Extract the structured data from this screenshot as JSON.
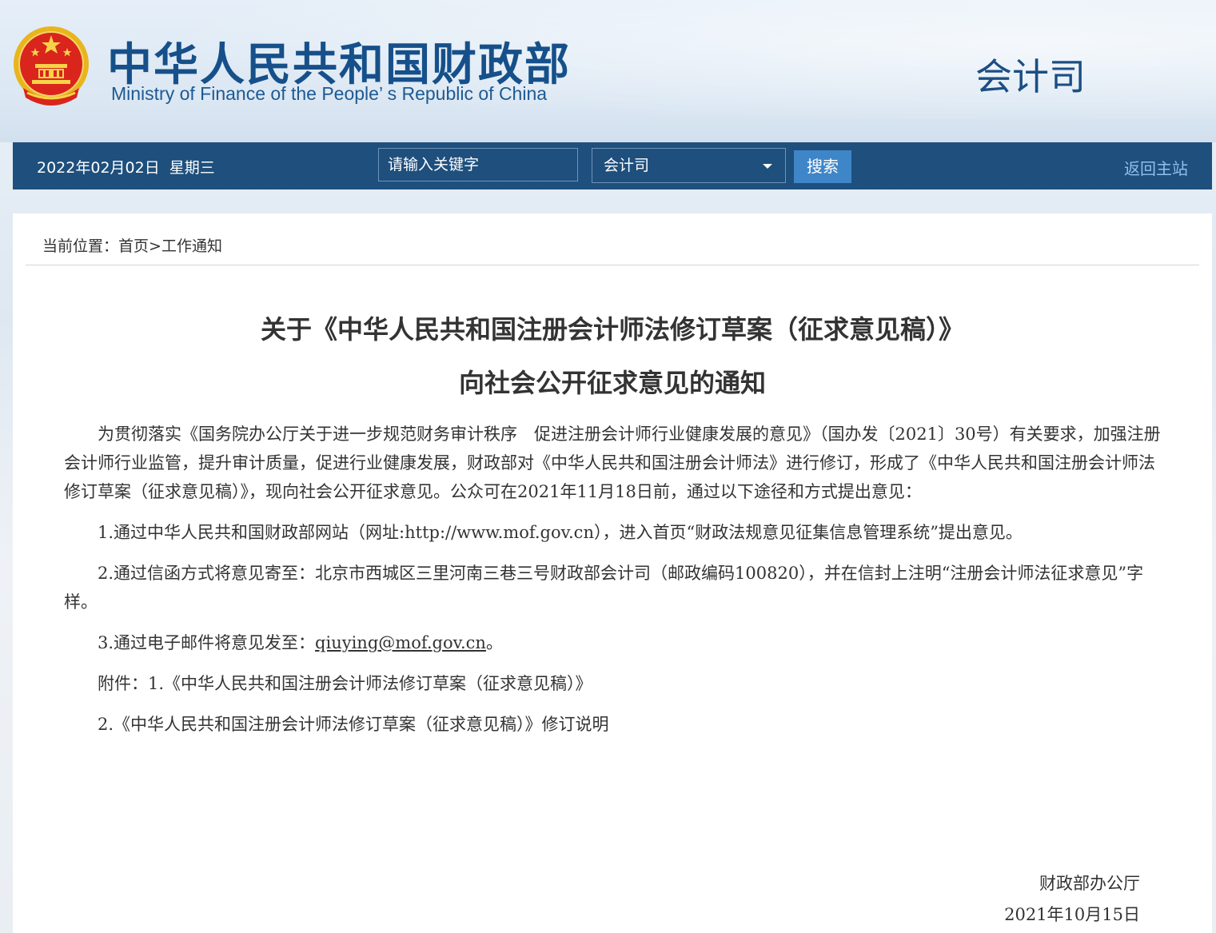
{
  "header": {
    "title_cn": "中华人民共和国财政部",
    "title_en": "Ministry of Finance of the People’ s Republic of China",
    "department": "会计司"
  },
  "navbar": {
    "date": "2022年02月02日",
    "weekday": "星期三",
    "search_placeholder": "请输入关键字",
    "scope_selected": "会计司",
    "search_button": "搜索",
    "home_link": "返回主站"
  },
  "breadcrumb": {
    "label": "当前位置：",
    "home": "首页",
    "separator": ">",
    "current": "工作通知"
  },
  "article": {
    "title_line1": "关于《中华人民共和国注册会计师法修订草案（征求意见稿）》",
    "title_line2": "向社会公开征求意见的通知",
    "intro": "为贯彻落实《国务院办公厅关于进一步规范财务审计秩序　促进注册会计师行业健康发展的意见》（国办发〔2021〕30号）有关要求，加强注册会计师行业监管，提升审计质量，促进行业健康发展，财政部对《中华人民共和国注册会计师法》进行修订，形成了《中华人民共和国注册会计师法修订草案（征求意见稿）》，现向社会公开征求意见。公众可在2021年11月18日前，通过以下途径和方式提出意见：",
    "item1": "1.通过中华人民共和国财政部网站（网址:http://www.mof.gov.cn），进入首页“财政法规意见征集信息管理系统”提出意见。",
    "item2": "2.通过信函方式将意见寄至：北京市西城区三里河南三巷三号财政部会计司（邮政编码100820），并在信封上注明“注册会计师法征求意见”字样。",
    "item3_prefix": "3.通过电子邮件将意见发至：",
    "item3_email": "qiuying@mof.gov.cn",
    "item3_suffix": "。",
    "attachment1": "附件：1.《中华人民共和国注册会计师法修订草案（征求意见稿）》",
    "attachment2": "2.《中华人民共和国注册会计师法修订草案（征求意见稿）》修订说明",
    "signature": "财政部办公厅",
    "sign_date": "2021年10月15日"
  },
  "colors": {
    "nav_bg": "#1e4f7d",
    "search_button_bg": "#3f86c8",
    "home_link": "#8fc0ec",
    "title_blue": "#16508a"
  }
}
